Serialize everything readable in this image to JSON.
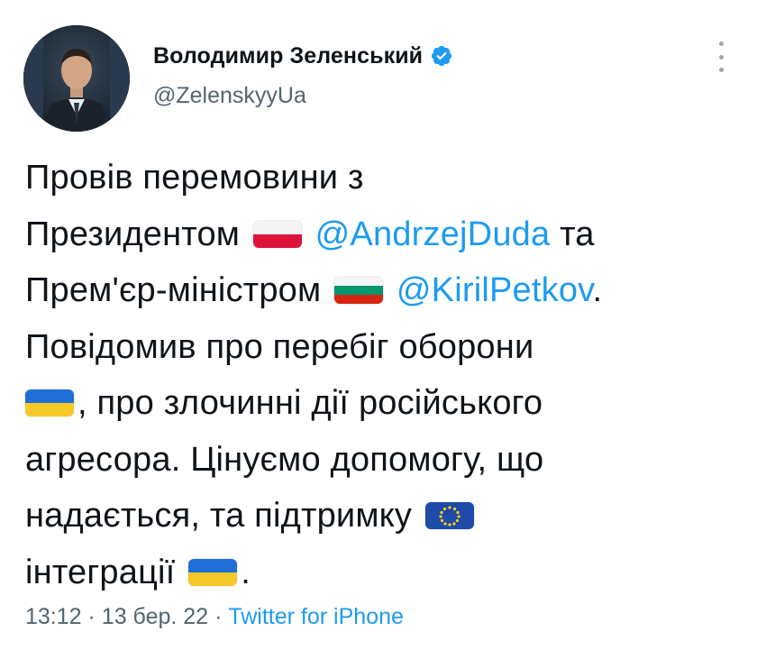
{
  "author": {
    "display_name": "Володимир Зеленський",
    "handle": "@ZelenskyyUa",
    "verified_icon": "verified-badge-icon",
    "avatar": "profile-photo"
  },
  "more_icon": "more-options-icon",
  "tweet": {
    "line1": "Провів перемовини з",
    "line2_a": "Президентом",
    "line2_flag": "flag-poland-icon",
    "line2_mention": "@AndrzejDuda",
    "line2_b": "та",
    "line3_a": "Прем'єр-міністром",
    "line3_flag": "flag-bulgaria-icon",
    "line3_mention": "@KirilPetkov",
    "line3_b": ".",
    "line4": "Повідомив про перебіг оборони",
    "line5_flag": "flag-ukraine-icon",
    "line5_a": ", про злочинні дії російського",
    "line6": "агресора. Цінуємо допомогу, що",
    "line7_a": "надається, та підтримку",
    "line7_flag": "flag-eu-icon",
    "line8_a": "інтеграції",
    "line8_flag": "flag-ukraine-icon",
    "line8_b": "."
  },
  "meta": {
    "time": "13:12",
    "sep1": "·",
    "date": "13 бер. 22",
    "sep2": "·",
    "source": "Twitter for iPhone"
  },
  "colors": {
    "link": "#1d9bf0",
    "secondary": "#536471",
    "text": "#0f1419",
    "verified": "#1d9bf0"
  }
}
